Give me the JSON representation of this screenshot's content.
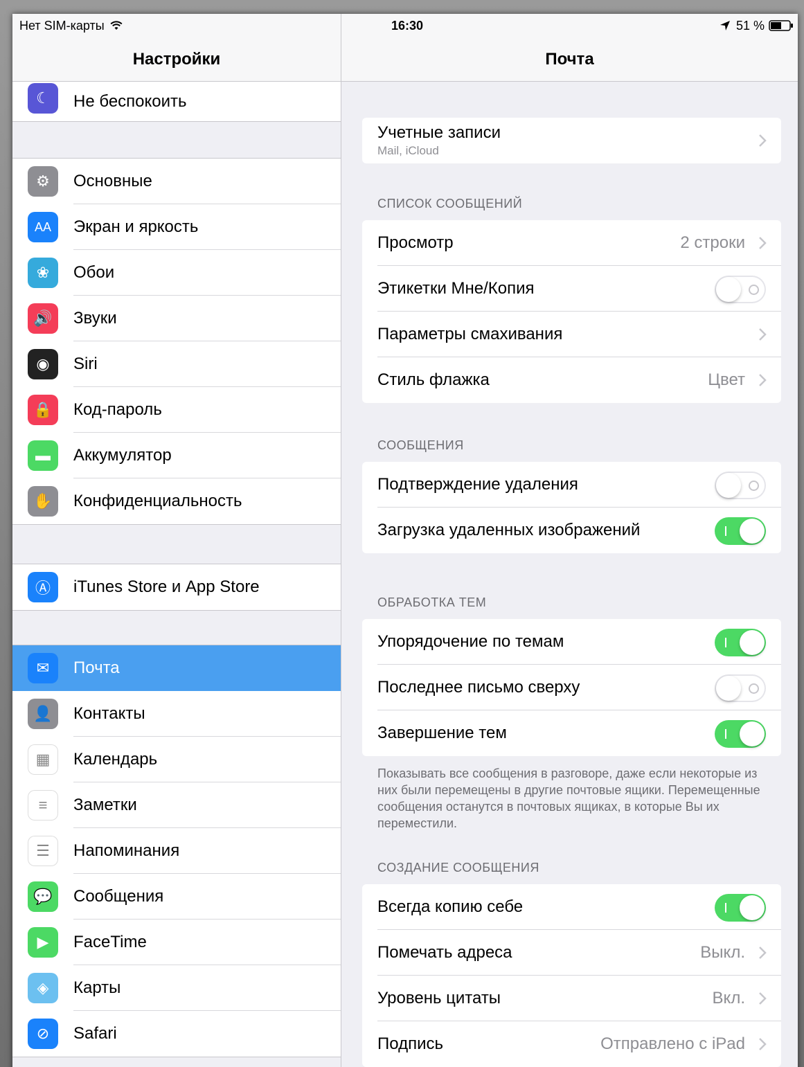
{
  "status": {
    "carrier": "Нет SIM-карты",
    "time": "16:30",
    "battery": "51 %"
  },
  "left": {
    "title": "Настройки",
    "groups": [
      [
        {
          "label": "Не беспокоить",
          "icon": "moon-icon",
          "color": "#5856d6"
        }
      ],
      [
        {
          "label": "Основные",
          "icon": "gear-icon",
          "color": "#8e8e93"
        },
        {
          "label": "Экран и яркость",
          "icon": "text-size-icon",
          "color": "#1a82fb"
        },
        {
          "label": "Обои",
          "icon": "flower-icon",
          "color": "#35aadc"
        },
        {
          "label": "Звуки",
          "icon": "speaker-icon",
          "color": "#f43d58"
        },
        {
          "label": "Siri",
          "icon": "siri-icon",
          "color": "#222"
        },
        {
          "label": "Код-пароль",
          "icon": "lock-icon",
          "color": "#f43d58"
        },
        {
          "label": "Аккумулятор",
          "icon": "battery-icon",
          "color": "#4cd964"
        },
        {
          "label": "Конфиденциальность",
          "icon": "hand-icon",
          "color": "#8e8e93"
        }
      ],
      [
        {
          "label": "iTunes Store и App Store",
          "icon": "app-store-icon",
          "color": "#1a82fb"
        }
      ],
      [
        {
          "label": "Почта",
          "icon": "mail-icon",
          "color": "#1a82fb",
          "selected": true
        },
        {
          "label": "Контакты",
          "icon": "contacts-icon",
          "color": "#8e8e93"
        },
        {
          "label": "Календарь",
          "icon": "calendar-icon",
          "color": "#ffffff"
        },
        {
          "label": "Заметки",
          "icon": "notes-icon",
          "color": "#ffffff"
        },
        {
          "label": "Напоминания",
          "icon": "reminders-icon",
          "color": "#ffffff"
        },
        {
          "label": "Сообщения",
          "icon": "messages-icon",
          "color": "#4cd964"
        },
        {
          "label": "FaceTime",
          "icon": "facetime-icon",
          "color": "#4cd964"
        },
        {
          "label": "Карты",
          "icon": "maps-icon",
          "color": "#6cc0f0"
        },
        {
          "label": "Safari",
          "icon": "safari-icon",
          "color": "#1a82fb"
        }
      ]
    ]
  },
  "right": {
    "title": "Почта",
    "accounts": {
      "label": "Учетные записи",
      "sub": "Mail, iCloud"
    },
    "sections": [
      {
        "header": "СПИСОК СООБЩЕНИЙ",
        "rows": [
          {
            "label": "Просмотр",
            "value": "2 строки",
            "type": "chevron"
          },
          {
            "label": "Этикетки Мне/Копия",
            "type": "toggle",
            "on": false
          },
          {
            "label": "Параметры смахивания",
            "value": "",
            "type": "chevron"
          },
          {
            "label": "Стиль флажка",
            "value": "Цвет",
            "type": "chevron"
          }
        ]
      },
      {
        "header": "СООБЩЕНИЯ",
        "rows": [
          {
            "label": "Подтверждение удаления",
            "type": "toggle",
            "on": false
          },
          {
            "label": "Загрузка удаленных изображений",
            "type": "toggle",
            "on": true
          }
        ]
      },
      {
        "header": "ОБРАБОТКА ТЕМ",
        "rows": [
          {
            "label": "Упорядочение по темам",
            "type": "toggle",
            "on": true
          },
          {
            "label": "Последнее письмо сверху",
            "type": "toggle",
            "on": false
          },
          {
            "label": "Завершение тем",
            "type": "toggle",
            "on": true
          }
        ]
      },
      {
        "header": "СОЗДАНИЕ СООБЩЕНИЯ",
        "rows": [
          {
            "label": "Всегда копию себе",
            "type": "toggle",
            "on": true
          },
          {
            "label": "Помечать адреса",
            "value": "Выкл.",
            "type": "chevron"
          },
          {
            "label": "Уровень цитаты",
            "value": "Вкл.",
            "type": "chevron"
          },
          {
            "label": "Подпись",
            "value": "Отправлено с iPad",
            "type": "chevron"
          }
        ]
      }
    ],
    "footer_threads": "Показывать все сообщения в разговоре, даже если некоторые из них были перемещены в другие почтовые ящики. Перемещенные сообщения останутся в почтовых ящиках, в которые Вы их переместили."
  }
}
